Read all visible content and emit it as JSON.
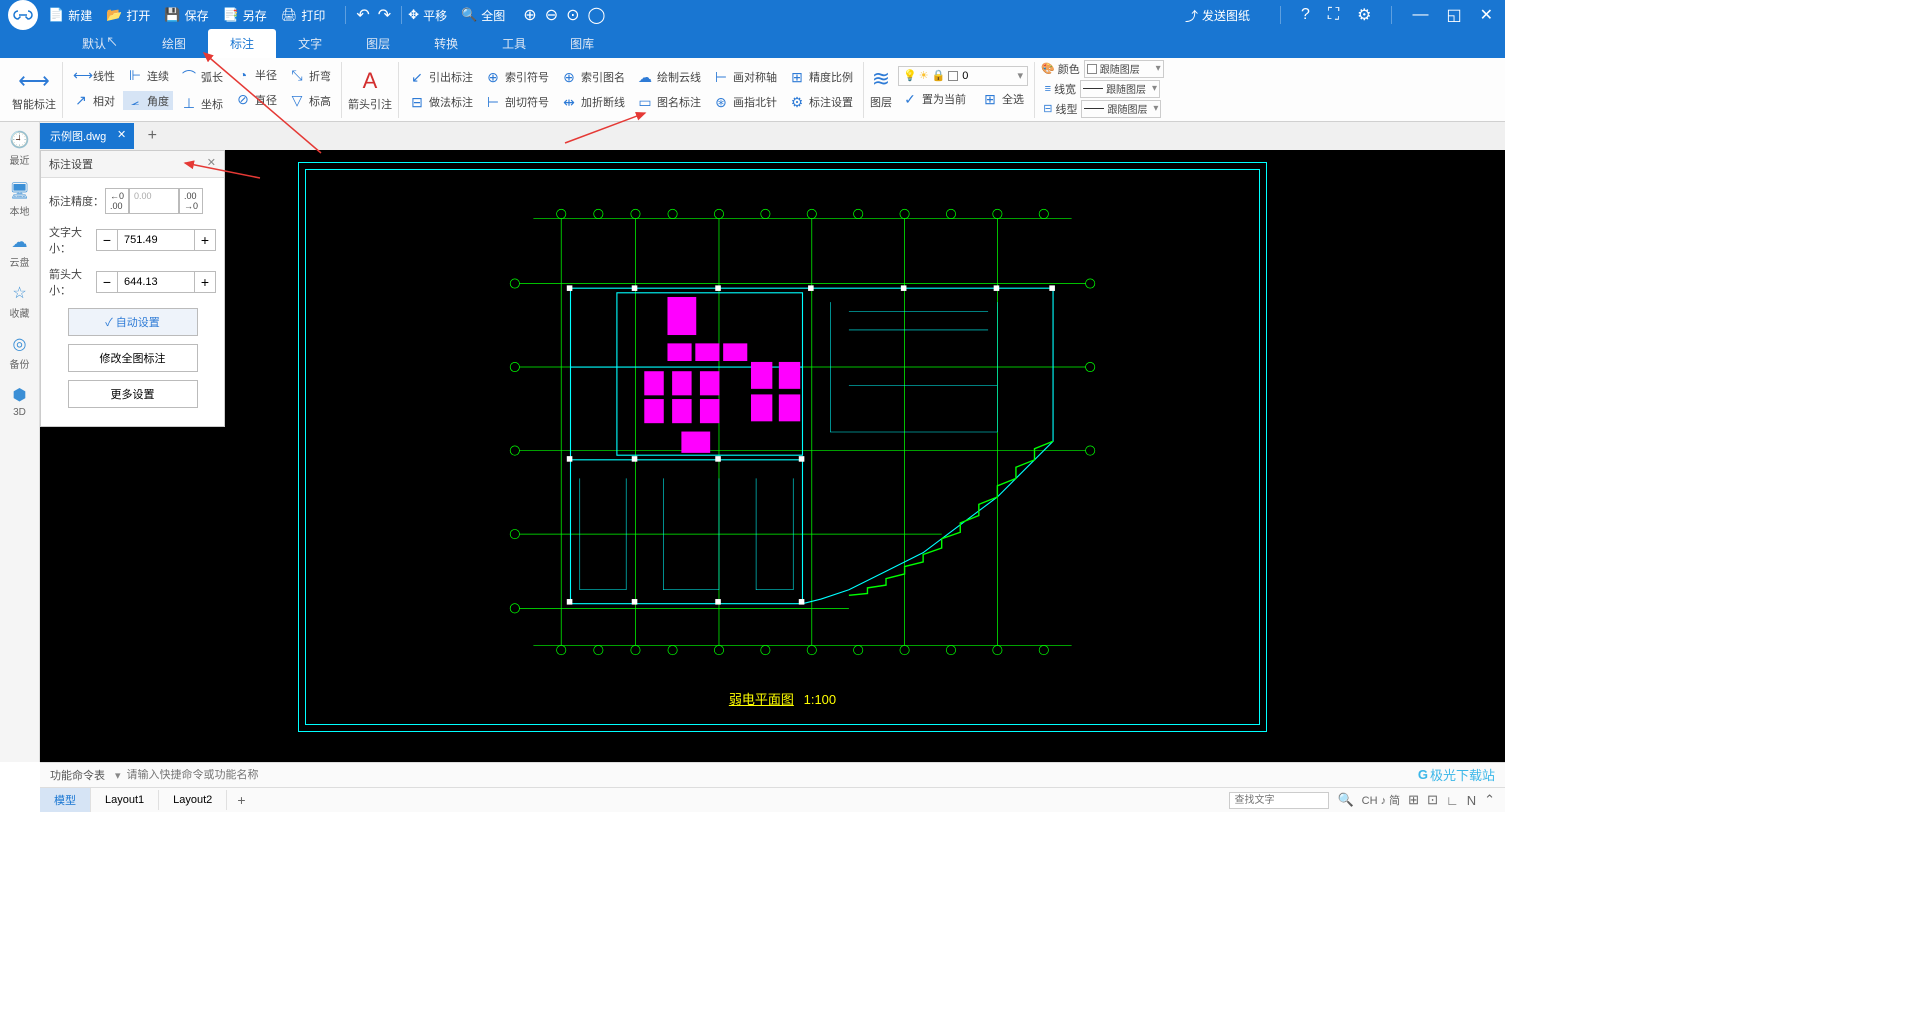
{
  "titlebar": {
    "new": "新建",
    "open": "打开",
    "save": "保存",
    "saveas": "另存",
    "print": "打印",
    "pan": "平移",
    "fullview": "全图",
    "send": "发送图纸"
  },
  "menutabs": [
    "默认",
    "绘图",
    "标注",
    "文字",
    "图层",
    "转换",
    "工具",
    "图库"
  ],
  "ribbon": {
    "smart": "智能标注",
    "g1": {
      "r1c1": "线性",
      "r1c2": "连续",
      "r1c3": "弧长",
      "r1c4": "半径",
      "r1c5": "折弯",
      "r2c1": "相对",
      "r2c2": "角度",
      "r2c3": "坐标",
      "r2c4": "直径",
      "r2c5": "标高"
    },
    "g2big": "箭头引注",
    "g2": {
      "r1c1": "引出标注",
      "r1c2": "索引符号",
      "r1c3": "索引图名",
      "r1c4": "绘制云线",
      "r1c5": "画对称轴",
      "r1c6": "精度比例",
      "r2c1": "做法标注",
      "r2c2": "剖切符号",
      "r2c3": "加折断线",
      "r2c4": "图名标注",
      "r2c5": "画指北针",
      "r2c6": "标注设置"
    },
    "layer_big": "图层",
    "layer_btns": {
      "a": "置为当前",
      "b": "全选"
    },
    "layer_val": "0",
    "prop": {
      "color": "颜色",
      "lw": "线宽",
      "lt": "线型",
      "follow": "跟随图层"
    }
  },
  "leftbar": [
    {
      "ico": "🕘",
      "lbl": "最近"
    },
    {
      "ico": "🖥",
      "lbl": "本地"
    },
    {
      "ico": "☁",
      "lbl": "云盘"
    },
    {
      "ico": "☆",
      "lbl": "收藏"
    },
    {
      "ico": "◎",
      "lbl": "备份"
    },
    {
      "ico": "⬢",
      "lbl": "3D"
    }
  ],
  "filetab": "示例图.dwg",
  "settings": {
    "title": "标注设置",
    "precision_lbl": "标注精度：",
    "precision_ph": "0.00",
    "textsize_lbl": "文字大小：",
    "textsize_val": "751.49",
    "arrowsize_lbl": "箭头大小：",
    "arrowsize_val": "644.13",
    "auto": "自动设置",
    "modify": "修改全图标注",
    "more": "更多设置"
  },
  "drawing": {
    "title": "弱电平面图",
    "scale": "1:100"
  },
  "cmdbar": {
    "lbl": "功能命令表",
    "ph": "请输入快捷命令或功能名称"
  },
  "layouts": [
    "模型",
    "Layout1",
    "Layout2"
  ],
  "status": {
    "search_ph": "查找文字",
    "ime": "CH ♪ 简"
  }
}
